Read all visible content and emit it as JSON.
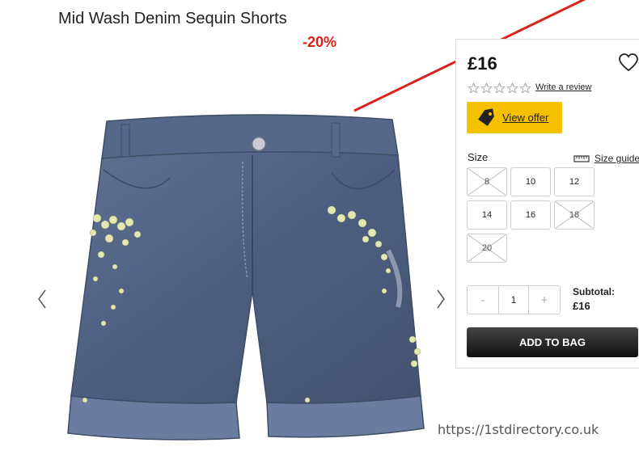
{
  "product": {
    "title": "Mid Wash Denim Sequin Shorts",
    "discount_badge": "-20%",
    "image_icon": "denim-shorts-image"
  },
  "gallery": {
    "prev_icon": "chevron-left-icon",
    "next_icon": "chevron-right-icon"
  },
  "purchase": {
    "price": "£16",
    "wishlist_icon": "heart-icon",
    "rating_stars_filled": 0,
    "rating_stars_total": 5,
    "review_link": "Write a review",
    "offer_button": "View offer",
    "offer_icon": "tag-icon",
    "size_label": "Size",
    "size_guide": "Size guide",
    "size_guide_icon": "ruler-icon",
    "sizes": [
      {
        "label": "8",
        "available": false
      },
      {
        "label": "10",
        "available": true
      },
      {
        "label": "12",
        "available": true
      },
      {
        "label": "14",
        "available": true
      },
      {
        "label": "16",
        "available": true
      },
      {
        "label": "18",
        "available": false
      },
      {
        "label": "20",
        "available": false
      }
    ],
    "quantity": {
      "minus": "-",
      "value": "1",
      "plus": "+"
    },
    "subtotal_label": "Subtotal:",
    "subtotal_value": "£16",
    "add_to_bag": "ADD TO BAG"
  },
  "colors": {
    "discount": "#e0201b",
    "offer_button": "#f5c000",
    "add_button": "#1a1a1a",
    "annotation_line": "#d9241c"
  },
  "watermark": "https://1stdirectory.co.uk"
}
